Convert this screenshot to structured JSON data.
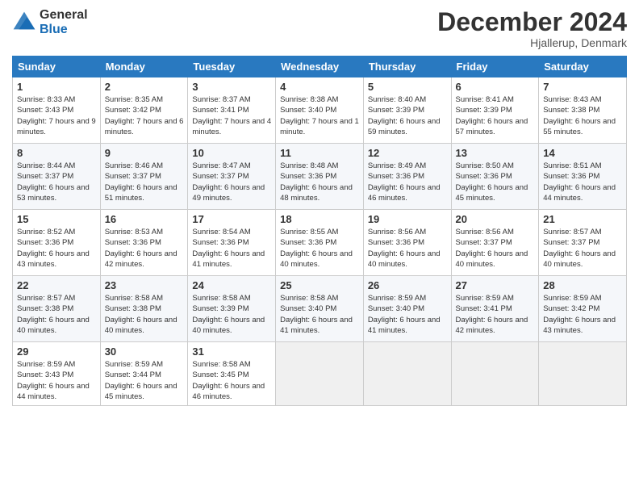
{
  "header": {
    "logo_general": "General",
    "logo_blue": "Blue",
    "month_title": "December 2024",
    "location": "Hjallerup, Denmark"
  },
  "days_of_week": [
    "Sunday",
    "Monday",
    "Tuesday",
    "Wednesday",
    "Thursday",
    "Friday",
    "Saturday"
  ],
  "weeks": [
    [
      {
        "day": "1",
        "sunrise": "8:33 AM",
        "sunset": "3:43 PM",
        "daylight": "7 hours and 9 minutes"
      },
      {
        "day": "2",
        "sunrise": "8:35 AM",
        "sunset": "3:42 PM",
        "daylight": "7 hours and 6 minutes"
      },
      {
        "day": "3",
        "sunrise": "8:37 AM",
        "sunset": "3:41 PM",
        "daylight": "7 hours and 4 minutes"
      },
      {
        "day": "4",
        "sunrise": "8:38 AM",
        "sunset": "3:40 PM",
        "daylight": "7 hours and 1 minute"
      },
      {
        "day": "5",
        "sunrise": "8:40 AM",
        "sunset": "3:39 PM",
        "daylight": "6 hours and 59 minutes"
      },
      {
        "day": "6",
        "sunrise": "8:41 AM",
        "sunset": "3:39 PM",
        "daylight": "6 hours and 57 minutes"
      },
      {
        "day": "7",
        "sunrise": "8:43 AM",
        "sunset": "3:38 PM",
        "daylight": "6 hours and 55 minutes"
      }
    ],
    [
      {
        "day": "8",
        "sunrise": "8:44 AM",
        "sunset": "3:37 PM",
        "daylight": "6 hours and 53 minutes"
      },
      {
        "day": "9",
        "sunrise": "8:46 AM",
        "sunset": "3:37 PM",
        "daylight": "6 hours and 51 minutes"
      },
      {
        "day": "10",
        "sunrise": "8:47 AM",
        "sunset": "3:37 PM",
        "daylight": "6 hours and 49 minutes"
      },
      {
        "day": "11",
        "sunrise": "8:48 AM",
        "sunset": "3:36 PM",
        "daylight": "6 hours and 48 minutes"
      },
      {
        "day": "12",
        "sunrise": "8:49 AM",
        "sunset": "3:36 PM",
        "daylight": "6 hours and 46 minutes"
      },
      {
        "day": "13",
        "sunrise": "8:50 AM",
        "sunset": "3:36 PM",
        "daylight": "6 hours and 45 minutes"
      },
      {
        "day": "14",
        "sunrise": "8:51 AM",
        "sunset": "3:36 PM",
        "daylight": "6 hours and 44 minutes"
      }
    ],
    [
      {
        "day": "15",
        "sunrise": "8:52 AM",
        "sunset": "3:36 PM",
        "daylight": "6 hours and 43 minutes"
      },
      {
        "day": "16",
        "sunrise": "8:53 AM",
        "sunset": "3:36 PM",
        "daylight": "6 hours and 42 minutes"
      },
      {
        "day": "17",
        "sunrise": "8:54 AM",
        "sunset": "3:36 PM",
        "daylight": "6 hours and 41 minutes"
      },
      {
        "day": "18",
        "sunrise": "8:55 AM",
        "sunset": "3:36 PM",
        "daylight": "6 hours and 40 minutes"
      },
      {
        "day": "19",
        "sunrise": "8:56 AM",
        "sunset": "3:36 PM",
        "daylight": "6 hours and 40 minutes"
      },
      {
        "day": "20",
        "sunrise": "8:56 AM",
        "sunset": "3:37 PM",
        "daylight": "6 hours and 40 minutes"
      },
      {
        "day": "21",
        "sunrise": "8:57 AM",
        "sunset": "3:37 PM",
        "daylight": "6 hours and 40 minutes"
      }
    ],
    [
      {
        "day": "22",
        "sunrise": "8:57 AM",
        "sunset": "3:38 PM",
        "daylight": "6 hours and 40 minutes"
      },
      {
        "day": "23",
        "sunrise": "8:58 AM",
        "sunset": "3:38 PM",
        "daylight": "6 hours and 40 minutes"
      },
      {
        "day": "24",
        "sunrise": "8:58 AM",
        "sunset": "3:39 PM",
        "daylight": "6 hours and 40 minutes"
      },
      {
        "day": "25",
        "sunrise": "8:58 AM",
        "sunset": "3:40 PM",
        "daylight": "6 hours and 41 minutes"
      },
      {
        "day": "26",
        "sunrise": "8:59 AM",
        "sunset": "3:40 PM",
        "daylight": "6 hours and 41 minutes"
      },
      {
        "day": "27",
        "sunrise": "8:59 AM",
        "sunset": "3:41 PM",
        "daylight": "6 hours and 42 minutes"
      },
      {
        "day": "28",
        "sunrise": "8:59 AM",
        "sunset": "3:42 PM",
        "daylight": "6 hours and 43 minutes"
      }
    ],
    [
      {
        "day": "29",
        "sunrise": "8:59 AM",
        "sunset": "3:43 PM",
        "daylight": "6 hours and 44 minutes"
      },
      {
        "day": "30",
        "sunrise": "8:59 AM",
        "sunset": "3:44 PM",
        "daylight": "6 hours and 45 minutes"
      },
      {
        "day": "31",
        "sunrise": "8:58 AM",
        "sunset": "3:45 PM",
        "daylight": "6 hours and 46 minutes"
      },
      null,
      null,
      null,
      null
    ]
  ]
}
